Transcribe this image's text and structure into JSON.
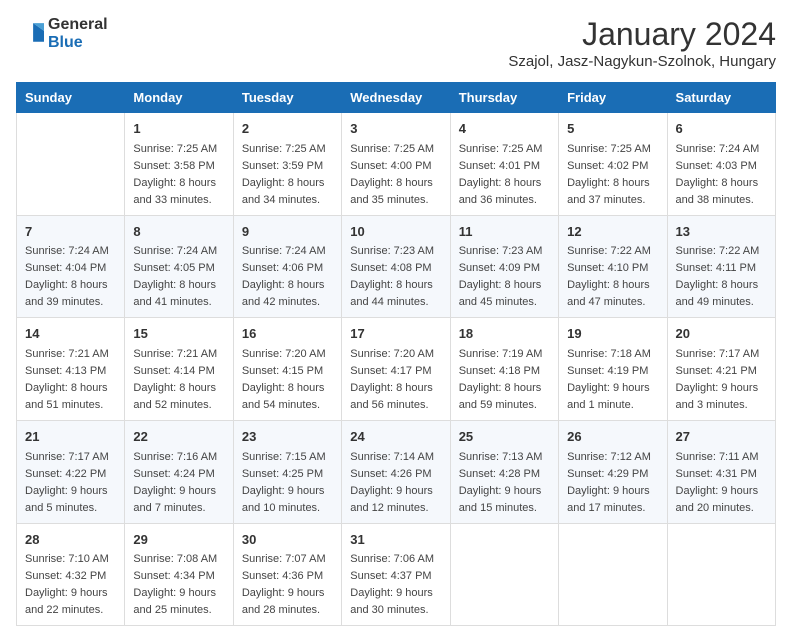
{
  "logo": {
    "line1": "General",
    "line2": "Blue"
  },
  "title": "January 2024",
  "location": "Szajol, Jasz-Nagykun-Szolnok, Hungary",
  "days_of_week": [
    "Sunday",
    "Monday",
    "Tuesday",
    "Wednesday",
    "Thursday",
    "Friday",
    "Saturday"
  ],
  "weeks": [
    [
      {
        "day": "",
        "sunrise": "",
        "sunset": "",
        "daylight": ""
      },
      {
        "day": "1",
        "sunrise": "Sunrise: 7:25 AM",
        "sunset": "Sunset: 3:58 PM",
        "daylight": "Daylight: 8 hours and 33 minutes."
      },
      {
        "day": "2",
        "sunrise": "Sunrise: 7:25 AM",
        "sunset": "Sunset: 3:59 PM",
        "daylight": "Daylight: 8 hours and 34 minutes."
      },
      {
        "day": "3",
        "sunrise": "Sunrise: 7:25 AM",
        "sunset": "Sunset: 4:00 PM",
        "daylight": "Daylight: 8 hours and 35 minutes."
      },
      {
        "day": "4",
        "sunrise": "Sunrise: 7:25 AM",
        "sunset": "Sunset: 4:01 PM",
        "daylight": "Daylight: 8 hours and 36 minutes."
      },
      {
        "day": "5",
        "sunrise": "Sunrise: 7:25 AM",
        "sunset": "Sunset: 4:02 PM",
        "daylight": "Daylight: 8 hours and 37 minutes."
      },
      {
        "day": "6",
        "sunrise": "Sunrise: 7:24 AM",
        "sunset": "Sunset: 4:03 PM",
        "daylight": "Daylight: 8 hours and 38 minutes."
      }
    ],
    [
      {
        "day": "7",
        "sunrise": "Sunrise: 7:24 AM",
        "sunset": "Sunset: 4:04 PM",
        "daylight": "Daylight: 8 hours and 39 minutes."
      },
      {
        "day": "8",
        "sunrise": "Sunrise: 7:24 AM",
        "sunset": "Sunset: 4:05 PM",
        "daylight": "Daylight: 8 hours and 41 minutes."
      },
      {
        "day": "9",
        "sunrise": "Sunrise: 7:24 AM",
        "sunset": "Sunset: 4:06 PM",
        "daylight": "Daylight: 8 hours and 42 minutes."
      },
      {
        "day": "10",
        "sunrise": "Sunrise: 7:23 AM",
        "sunset": "Sunset: 4:08 PM",
        "daylight": "Daylight: 8 hours and 44 minutes."
      },
      {
        "day": "11",
        "sunrise": "Sunrise: 7:23 AM",
        "sunset": "Sunset: 4:09 PM",
        "daylight": "Daylight: 8 hours and 45 minutes."
      },
      {
        "day": "12",
        "sunrise": "Sunrise: 7:22 AM",
        "sunset": "Sunset: 4:10 PM",
        "daylight": "Daylight: 8 hours and 47 minutes."
      },
      {
        "day": "13",
        "sunrise": "Sunrise: 7:22 AM",
        "sunset": "Sunset: 4:11 PM",
        "daylight": "Daylight: 8 hours and 49 minutes."
      }
    ],
    [
      {
        "day": "14",
        "sunrise": "Sunrise: 7:21 AM",
        "sunset": "Sunset: 4:13 PM",
        "daylight": "Daylight: 8 hours and 51 minutes."
      },
      {
        "day": "15",
        "sunrise": "Sunrise: 7:21 AM",
        "sunset": "Sunset: 4:14 PM",
        "daylight": "Daylight: 8 hours and 52 minutes."
      },
      {
        "day": "16",
        "sunrise": "Sunrise: 7:20 AM",
        "sunset": "Sunset: 4:15 PM",
        "daylight": "Daylight: 8 hours and 54 minutes."
      },
      {
        "day": "17",
        "sunrise": "Sunrise: 7:20 AM",
        "sunset": "Sunset: 4:17 PM",
        "daylight": "Daylight: 8 hours and 56 minutes."
      },
      {
        "day": "18",
        "sunrise": "Sunrise: 7:19 AM",
        "sunset": "Sunset: 4:18 PM",
        "daylight": "Daylight: 8 hours and 59 minutes."
      },
      {
        "day": "19",
        "sunrise": "Sunrise: 7:18 AM",
        "sunset": "Sunset: 4:19 PM",
        "daylight": "Daylight: 9 hours and 1 minute."
      },
      {
        "day": "20",
        "sunrise": "Sunrise: 7:17 AM",
        "sunset": "Sunset: 4:21 PM",
        "daylight": "Daylight: 9 hours and 3 minutes."
      }
    ],
    [
      {
        "day": "21",
        "sunrise": "Sunrise: 7:17 AM",
        "sunset": "Sunset: 4:22 PM",
        "daylight": "Daylight: 9 hours and 5 minutes."
      },
      {
        "day": "22",
        "sunrise": "Sunrise: 7:16 AM",
        "sunset": "Sunset: 4:24 PM",
        "daylight": "Daylight: 9 hours and 7 minutes."
      },
      {
        "day": "23",
        "sunrise": "Sunrise: 7:15 AM",
        "sunset": "Sunset: 4:25 PM",
        "daylight": "Daylight: 9 hours and 10 minutes."
      },
      {
        "day": "24",
        "sunrise": "Sunrise: 7:14 AM",
        "sunset": "Sunset: 4:26 PM",
        "daylight": "Daylight: 9 hours and 12 minutes."
      },
      {
        "day": "25",
        "sunrise": "Sunrise: 7:13 AM",
        "sunset": "Sunset: 4:28 PM",
        "daylight": "Daylight: 9 hours and 15 minutes."
      },
      {
        "day": "26",
        "sunrise": "Sunrise: 7:12 AM",
        "sunset": "Sunset: 4:29 PM",
        "daylight": "Daylight: 9 hours and 17 minutes."
      },
      {
        "day": "27",
        "sunrise": "Sunrise: 7:11 AM",
        "sunset": "Sunset: 4:31 PM",
        "daylight": "Daylight: 9 hours and 20 minutes."
      }
    ],
    [
      {
        "day": "28",
        "sunrise": "Sunrise: 7:10 AM",
        "sunset": "Sunset: 4:32 PM",
        "daylight": "Daylight: 9 hours and 22 minutes."
      },
      {
        "day": "29",
        "sunrise": "Sunrise: 7:08 AM",
        "sunset": "Sunset: 4:34 PM",
        "daylight": "Daylight: 9 hours and 25 minutes."
      },
      {
        "day": "30",
        "sunrise": "Sunrise: 7:07 AM",
        "sunset": "Sunset: 4:36 PM",
        "daylight": "Daylight: 9 hours and 28 minutes."
      },
      {
        "day": "31",
        "sunrise": "Sunrise: 7:06 AM",
        "sunset": "Sunset: 4:37 PM",
        "daylight": "Daylight: 9 hours and 30 minutes."
      },
      {
        "day": "",
        "sunrise": "",
        "sunset": "",
        "daylight": ""
      },
      {
        "day": "",
        "sunrise": "",
        "sunset": "",
        "daylight": ""
      },
      {
        "day": "",
        "sunrise": "",
        "sunset": "",
        "daylight": ""
      }
    ]
  ]
}
